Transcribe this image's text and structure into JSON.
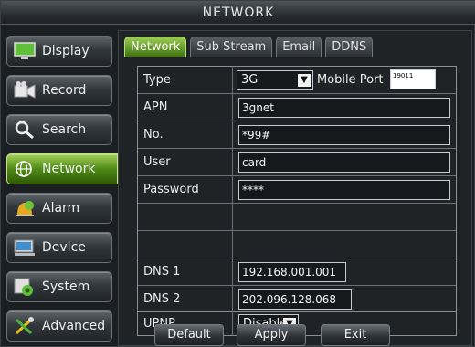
{
  "title": "NETWORK",
  "sidebar": {
    "items": [
      {
        "label": "Display",
        "icon": "monitor-icon"
      },
      {
        "label": "Record",
        "icon": "record-icon"
      },
      {
        "label": "Search",
        "icon": "search-icon"
      },
      {
        "label": "Network",
        "icon": "network-icon",
        "active": true
      },
      {
        "label": "Alarm",
        "icon": "alarm-icon"
      },
      {
        "label": "Device",
        "icon": "device-icon"
      },
      {
        "label": "System",
        "icon": "system-icon"
      },
      {
        "label": "Advanced",
        "icon": "tools-icon"
      }
    ]
  },
  "tabs": [
    {
      "label": "Network",
      "active": true
    },
    {
      "label": "Sub Stream"
    },
    {
      "label": "Email"
    },
    {
      "label": "DDNS"
    }
  ],
  "form": {
    "type": {
      "label": "Type",
      "value": "3G",
      "mobile_port_label": "Mobile Port",
      "mobile_port_value": "19011"
    },
    "apn": {
      "label": "APN",
      "value": "3gnet"
    },
    "number": {
      "label": "No.",
      "value": "*99#"
    },
    "user": {
      "label": "User",
      "value": "card"
    },
    "password": {
      "label": "Password",
      "value": "****"
    },
    "dns1": {
      "label": "DNS 1",
      "value": "192.168.001.001"
    },
    "dns2": {
      "label": "DNS 2",
      "value": "202.096.128.068"
    },
    "upnp": {
      "label": "UPNP",
      "value": "Disable"
    }
  },
  "buttons": {
    "default": "Default",
    "apply": "Apply",
    "exit": "Exit"
  },
  "colors": {
    "accent_green": "#4f8a16",
    "background": "#1b1f22"
  }
}
